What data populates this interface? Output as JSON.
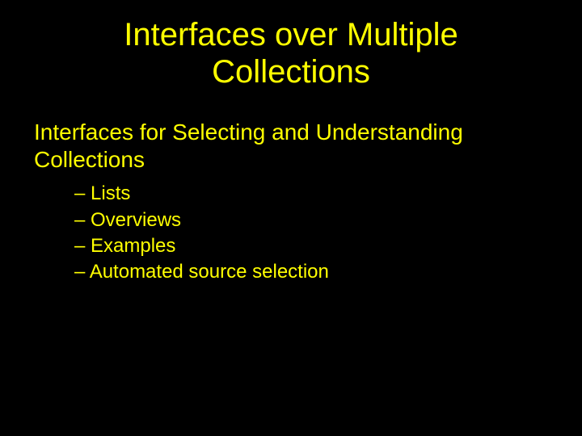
{
  "title_line1": "Interfaces over Multiple",
  "title_line2": "Collections",
  "subtitle_line1": "Interfaces for Selecting and Understanding",
  "subtitle_line2": "Collections",
  "bullets": {
    "b0": "– Lists",
    "b1": "– Overviews",
    "b2": "– Examples",
    "b3": "– Automated source selection"
  }
}
